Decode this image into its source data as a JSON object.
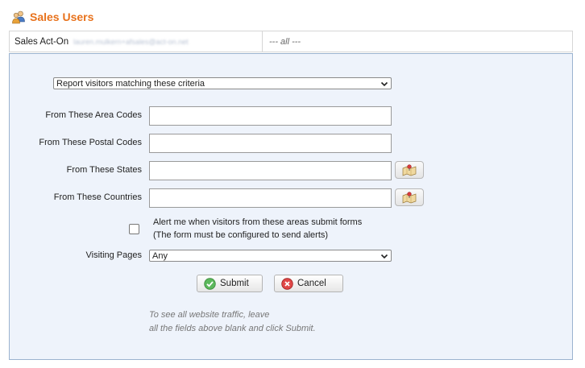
{
  "header": {
    "title": "Sales Users",
    "icon": "users-icon"
  },
  "info_row": {
    "label": "Sales Act-On",
    "email": "lauren.mulkern+afsales@act-on.net",
    "filter": "--- all ---"
  },
  "form": {
    "criteria_select": "Report visitors matching these criteria",
    "area_codes_label": "From These Area Codes",
    "area_codes_value": "",
    "postal_codes_label": "From These Postal Codes",
    "postal_codes_value": "",
    "states_label": "From These States",
    "states_value": "",
    "countries_label": "From These Countries",
    "countries_value": "",
    "alert_line1": "Alert me when visitors from these areas submit forms",
    "alert_line2": "(The form must be configured to send alerts)",
    "alert_checked": false,
    "visiting_pages_label": "Visiting Pages",
    "visiting_pages_value": "Any",
    "submit_label": "Submit",
    "cancel_label": "Cancel",
    "hint_line1": "To see all website traffic, leave",
    "hint_line2": "all the fields above blank and click Submit."
  },
  "colors": {
    "title": "#e8721c",
    "panel_bg": "#eef3fb",
    "panel_border": "#9bb3cf",
    "submit_icon": "#4caf50",
    "cancel_icon": "#e03b3b"
  }
}
